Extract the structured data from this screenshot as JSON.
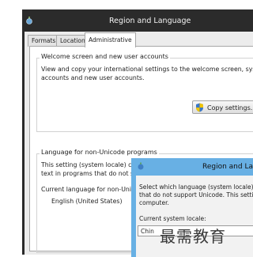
{
  "window": {
    "title": "Region and Language",
    "tabs": [
      {
        "label": "Formats"
      },
      {
        "label": "Location"
      },
      {
        "label": "Administrative"
      }
    ],
    "welcome_group": {
      "title": "Welcome screen and new user accounts",
      "line1": "View and copy your international settings to the welcome screen, syste",
      "line2": "accounts and new user accounts.",
      "button": "Copy settings..."
    },
    "unicode_group": {
      "title": "Language for non-Unicode programs",
      "line1": "This setting (system locale) controls the language used when displaying",
      "line2": "text in programs that do not su",
      "current_label": "Current language for non-Unic",
      "current_value": "English (United States)"
    }
  },
  "dialog": {
    "title": "Region and La",
    "line1": "Select which language (system locale)",
    "line2": "that do not support Unicode. This setti",
    "line3": "computer.",
    "current_label": "Current system locale:",
    "select_value": "Chin"
  },
  "watermark": "最需教育",
  "colors": {
    "titlebar": "#2b2b2b",
    "dialog_frame": "#68b0e4",
    "client": "#ececec"
  }
}
